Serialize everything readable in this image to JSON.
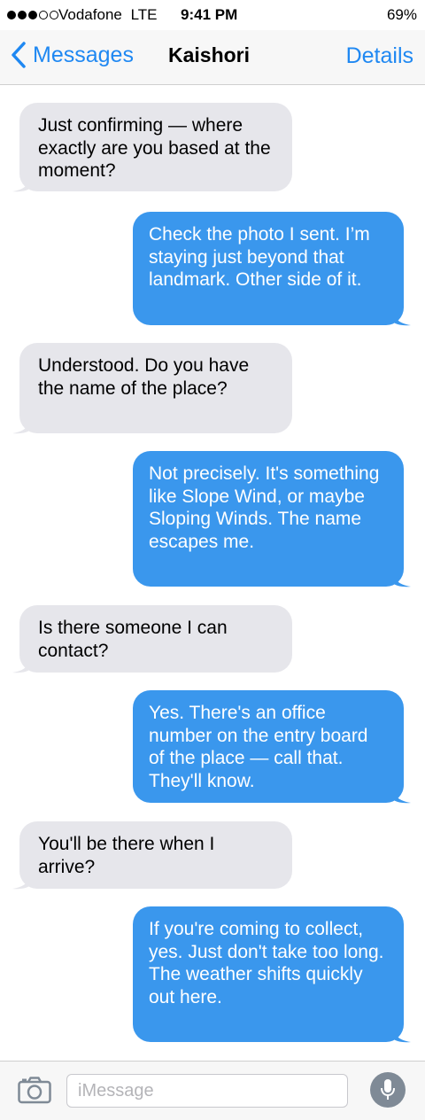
{
  "status_bar": {
    "carrier": "Vodafone",
    "network": "LTE",
    "time": "9:41 PM",
    "battery": "69%",
    "signal_bars_filled": 3,
    "signal_bars_total": 5
  },
  "nav": {
    "back_label": "Messages",
    "title": "Kaishori",
    "details_label": "Details"
  },
  "messages": [
    {
      "direction": "incoming",
      "text": "Just confirming — where exactly are you based at the moment?"
    },
    {
      "direction": "outgoing",
      "text": "Check the photo I sent. I’m staying just beyond that landmark. Other side of it."
    },
    {
      "direction": "incoming",
      "text": "Understood. Do you have the name of the place?"
    },
    {
      "direction": "outgoing",
      "text": "Not precisely. It's something like Slope Wind, or maybe Sloping Winds. The name escapes me."
    },
    {
      "direction": "incoming",
      "text": "Is there someone I can contact?"
    },
    {
      "direction": "outgoing",
      "text": "Yes. There's an office number on the entry board of the place — call that. They'll know."
    },
    {
      "direction": "incoming",
      "text": "You'll be there when I arrive?"
    },
    {
      "direction": "outgoing",
      "text": "If you're coming to collect, yes. Just don't take too long. The weather shifts quickly out here."
    }
  ],
  "input": {
    "placeholder": "iMessage",
    "value": ""
  },
  "colors": {
    "accent": "#1f88f2",
    "outgoing_bubble": "#3a97ed",
    "incoming_bubble": "#e6e6eb",
    "mic_button": "#7f8a96"
  },
  "icons": {
    "back": "chevron-left-icon",
    "camera": "camera-icon",
    "mic": "microphone-icon"
  }
}
